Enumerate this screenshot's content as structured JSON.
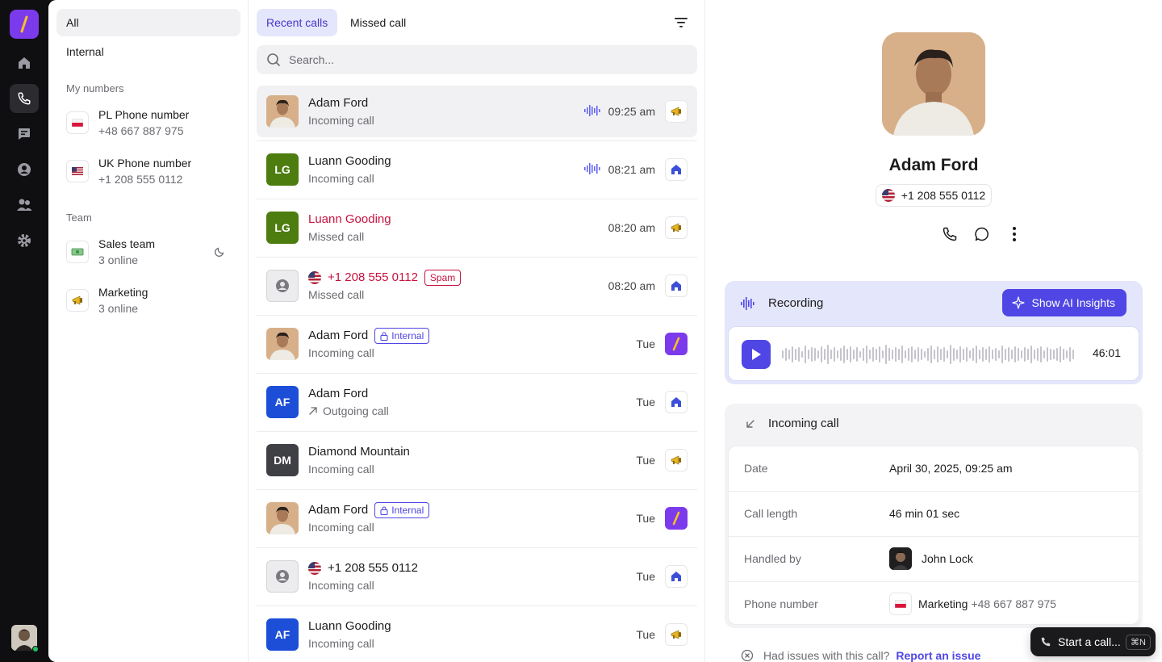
{
  "sidebar": {
    "filters": [
      {
        "label": "All",
        "active": true
      },
      {
        "label": "Internal",
        "active": false
      }
    ],
    "my_numbers_heading": "My numbers",
    "numbers": [
      {
        "title": "PL Phone number",
        "subtitle": "+48 667 887 975",
        "icon": "poland-flag-icon"
      },
      {
        "title": "UK Phone number",
        "subtitle": "+1 208 555 0112",
        "icon": "us-flag-icon"
      }
    ],
    "team_heading": "Team",
    "teams": [
      {
        "title": "Sales team",
        "subtitle": "3 online",
        "icon": "money-icon",
        "status_icon": "moon-icon"
      },
      {
        "title": "Marketing",
        "subtitle": "3 online",
        "icon": "megaphone-icon"
      }
    ]
  },
  "calls": {
    "tabs": [
      {
        "label": "Recent calls",
        "active": true
      },
      {
        "label": "Missed call",
        "active": false
      }
    ],
    "search_placeholder": "Search...",
    "rows": [
      {
        "name": "Adam Ford",
        "sub": "Incoming call",
        "time": "09:25 am",
        "avatar": "photo",
        "recording": true,
        "line": "megaphone-icon",
        "active": true
      },
      {
        "name": "Luann Gooding",
        "sub": "Incoming call",
        "time": "08:21 am",
        "avatar_initials": "LG",
        "avatar_color": "#4d7c0f",
        "recording": true,
        "line": "home-icon"
      },
      {
        "name": "Luann Gooding",
        "sub": "Missed call",
        "time": "08:20 am",
        "avatar_initials": "LG",
        "avatar_color": "#4d7c0f",
        "missed": true,
        "line": "megaphone-icon"
      },
      {
        "name": "+1 208 555 0112",
        "sub": "Missed call",
        "time": "08:20 am",
        "avatar": "unknown",
        "missed": true,
        "badge": "Spam",
        "flag": "us-flag-icon",
        "line": "home-icon"
      },
      {
        "name": "Adam Ford",
        "sub": "Incoming call",
        "time": "Tue",
        "avatar": "photo",
        "badge": "Internal",
        "line": "brand-logo-icon"
      },
      {
        "name": "Adam Ford",
        "sub": "Outgoing call",
        "time": "Tue",
        "avatar_initials": "AF",
        "avatar_color": "#1d4ed8",
        "outgoing": true,
        "line": "home-icon"
      },
      {
        "name": "Diamond Mountain",
        "sub": "Incoming call",
        "time": "Tue",
        "avatar_initials": "DM",
        "avatar_color": "#3f3f46",
        "line": "megaphone-icon"
      },
      {
        "name": "Adam Ford",
        "sub": "Incoming call",
        "time": "Tue",
        "avatar": "photo",
        "badge": "Internal",
        "line": "brand-logo-icon"
      },
      {
        "name": "+1 208 555 0112",
        "sub": "Incoming call",
        "time": "Tue",
        "avatar": "unknown",
        "flag": "us-flag-icon",
        "line": "home-icon"
      },
      {
        "name": "Luann Gooding",
        "sub": "Incoming call",
        "time": "Tue",
        "avatar_initials": "AF",
        "avatar_color": "#1d4ed8",
        "line": "megaphone-icon"
      }
    ]
  },
  "detail": {
    "name": "Adam Ford",
    "phone": "+1 208 555 0112",
    "recording": {
      "title": "Recording",
      "ai_button": "Show AI Insights",
      "duration": "46:01"
    },
    "call": {
      "title": "Incoming call",
      "fields": [
        {
          "key": "Date",
          "value": "April 30, 2025, 09:25 am"
        },
        {
          "key": "Call length",
          "value": "46 min 01 sec"
        },
        {
          "key": "Handled by",
          "value": "John Lock"
        },
        {
          "key": "Phone number",
          "value": "Marketing",
          "extra": "+48 667 887 975"
        }
      ]
    },
    "issue_text": "Had issues with this call?",
    "issue_link": "Report an issue"
  },
  "start_call": {
    "label": "Start a call...",
    "shortcut": "⌘N"
  },
  "colors": {
    "brand": "#7c3aed",
    "accent": "#4f46e5",
    "missed": "#c8123f"
  }
}
